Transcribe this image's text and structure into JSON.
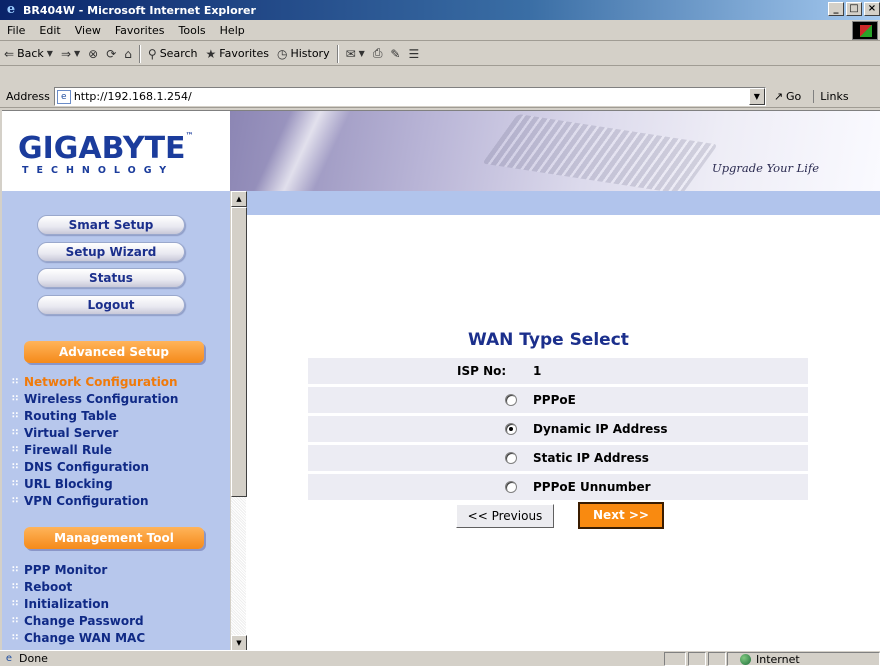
{
  "window": {
    "title": "BR404W - Microsoft Internet Explorer",
    "controls": [
      "_",
      "□",
      "×"
    ]
  },
  "menu": [
    "File",
    "Edit",
    "View",
    "Favorites",
    "Tools",
    "Help"
  ],
  "toolbar": {
    "back": "Back",
    "search": "Search",
    "favorites": "Favorites",
    "history": "History"
  },
  "address": {
    "label": "Address",
    "url": "http://192.168.1.254/",
    "go": "Go",
    "links": "Links"
  },
  "banner": {
    "logo": "GIGABYTE",
    "logo_tm": "™",
    "logo_sub": "TECHNOLOGY",
    "slogan": "Upgrade Your Life"
  },
  "sidebar": {
    "buttons": [
      "Smart Setup",
      "Setup Wizard",
      "Status",
      "Logout"
    ],
    "advanced_header": "Advanced Setup",
    "advanced_items": [
      "Network Configuration",
      "Wireless Configuration",
      "Routing Table",
      "Virtual Server",
      "Firewall Rule",
      "DNS Configuration",
      "URL Blocking",
      "VPN Configuration"
    ],
    "management_header": "Management Tool",
    "management_items": [
      "PPP Monitor",
      "Reboot",
      "Initialization",
      "Change Password",
      "Change WAN MAC"
    ]
  },
  "main": {
    "title": "WAN Type Select",
    "isp_label": "ISP No:",
    "isp_value": "1",
    "options": [
      {
        "label": "PPPoE",
        "selected": false
      },
      {
        "label": "Dynamic IP Address",
        "selected": true
      },
      {
        "label": "Static IP Address",
        "selected": false
      },
      {
        "label": "PPPoE Unnumber",
        "selected": false
      }
    ],
    "prev_button": "<< Previous",
    "next_button": "Next >>"
  },
  "status": {
    "text": "Done",
    "zone": "Internet"
  },
  "colors": {
    "brand_blue": "#1b2f8c",
    "accent_orange": "#f98a10",
    "sidebar_bg": "#b7c7ec"
  }
}
